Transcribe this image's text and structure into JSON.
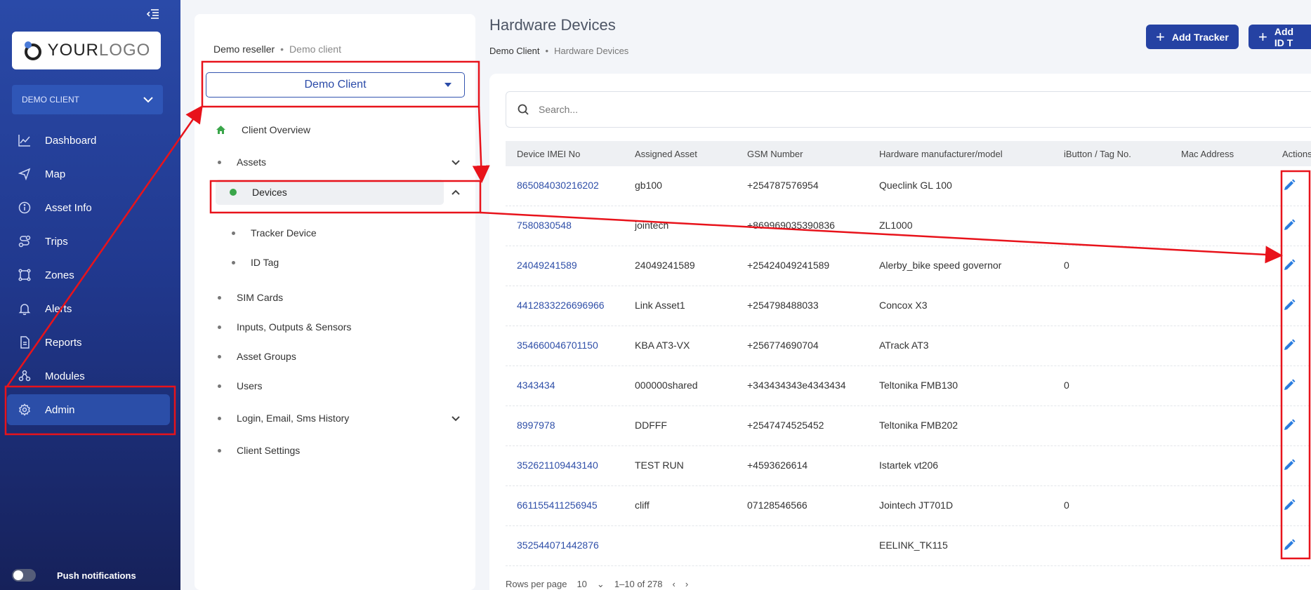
{
  "sidebar": {
    "logo": {
      "text_dark": "YOUR",
      "text_light": "LOGO"
    },
    "client_select": "DEMO CLIENT",
    "items": [
      {
        "label": "Dashboard",
        "icon": "chart-line-icon"
      },
      {
        "label": "Map",
        "icon": "navigation-icon"
      },
      {
        "label": "Asset Info",
        "icon": "info-icon"
      },
      {
        "label": "Trips",
        "icon": "route-icon"
      },
      {
        "label": "Zones",
        "icon": "zones-icon"
      },
      {
        "label": "Alerts",
        "icon": "bell-icon"
      },
      {
        "label": "Reports",
        "icon": "document-icon"
      },
      {
        "label": "Modules",
        "icon": "modules-icon"
      },
      {
        "label": "Admin",
        "icon": "gear-icon"
      }
    ],
    "push_label": "Push notifications"
  },
  "midpanel": {
    "crumb_main": "Demo reseller",
    "crumb_sub": "Demo client",
    "client_dropdown": "Demo Client",
    "items": {
      "overview": "Client Overview",
      "assets": "Assets",
      "devices": "Devices",
      "tracker": "Tracker Device",
      "idtag": "ID Tag",
      "sim": "SIM Cards",
      "io": "Inputs, Outputs & Sensors",
      "groups": "Asset Groups",
      "users": "Users",
      "history": "Login, Email, Sms History",
      "settings": "Client Settings"
    }
  },
  "main": {
    "title": "Hardware Devices",
    "crumb_main": "Demo Client",
    "crumb_sub": "Hardware Devices",
    "btn_add_tracker": "Add Tracker",
    "btn_add_id": "Add ID T",
    "search_placeholder": "Search...",
    "columns": [
      "Device IMEI No",
      "Assigned Asset",
      "GSM Number",
      "Hardware manufacturer/model",
      "iButton / Tag No.",
      "Mac Address",
      "Actions"
    ],
    "rows": [
      {
        "imei": "865084030216202",
        "asset": "gb100",
        "gsm": "+254787576954",
        "model": "Queclink GL 100",
        "tag": ""
      },
      {
        "imei": "7580830548",
        "asset": "jointech",
        "gsm": "+869969035390836",
        "model": "ZL1000",
        "tag": ""
      },
      {
        "imei": "24049241589",
        "asset": "24049241589",
        "gsm": "+25424049241589",
        "model": "Alerby_bike speed governor",
        "tag": "0"
      },
      {
        "imei": "4412833226696966",
        "asset": "Link Asset1",
        "gsm": "+254798488033",
        "model": "Concox X3",
        "tag": ""
      },
      {
        "imei": "354660046701150",
        "asset": "KBA AT3-VX",
        "gsm": "+256774690704",
        "model": "ATrack AT3",
        "tag": ""
      },
      {
        "imei": "4343434",
        "asset": "000000shared",
        "gsm": "+343434343e4343434",
        "model": "Teltonika FMB130",
        "tag": "0"
      },
      {
        "imei": "8997978",
        "asset": "DDFFF",
        "gsm": "+2547474525452",
        "model": "Teltonika FMB202",
        "tag": ""
      },
      {
        "imei": "352621109443140",
        "asset": "TEST RUN",
        "gsm": "+4593626614",
        "model": "Istartek vt206",
        "tag": ""
      },
      {
        "imei": "661155411256945",
        "asset": "cliff",
        "gsm": "07128546566",
        "model": "Jointech JT701D",
        "tag": "0"
      },
      {
        "imei": "352544071442876",
        "asset": "",
        "gsm": "",
        "model": "EELINK_TK115",
        "tag": ""
      }
    ],
    "pager": {
      "rows_label": "Rows per page",
      "rows_value": "10",
      "range": "1–10 of 278"
    }
  },
  "colors": {
    "sidebar": "#21398f",
    "accent": "#2542a3",
    "annotation": "#e8131b",
    "edit_icon": "#2b7de0"
  }
}
